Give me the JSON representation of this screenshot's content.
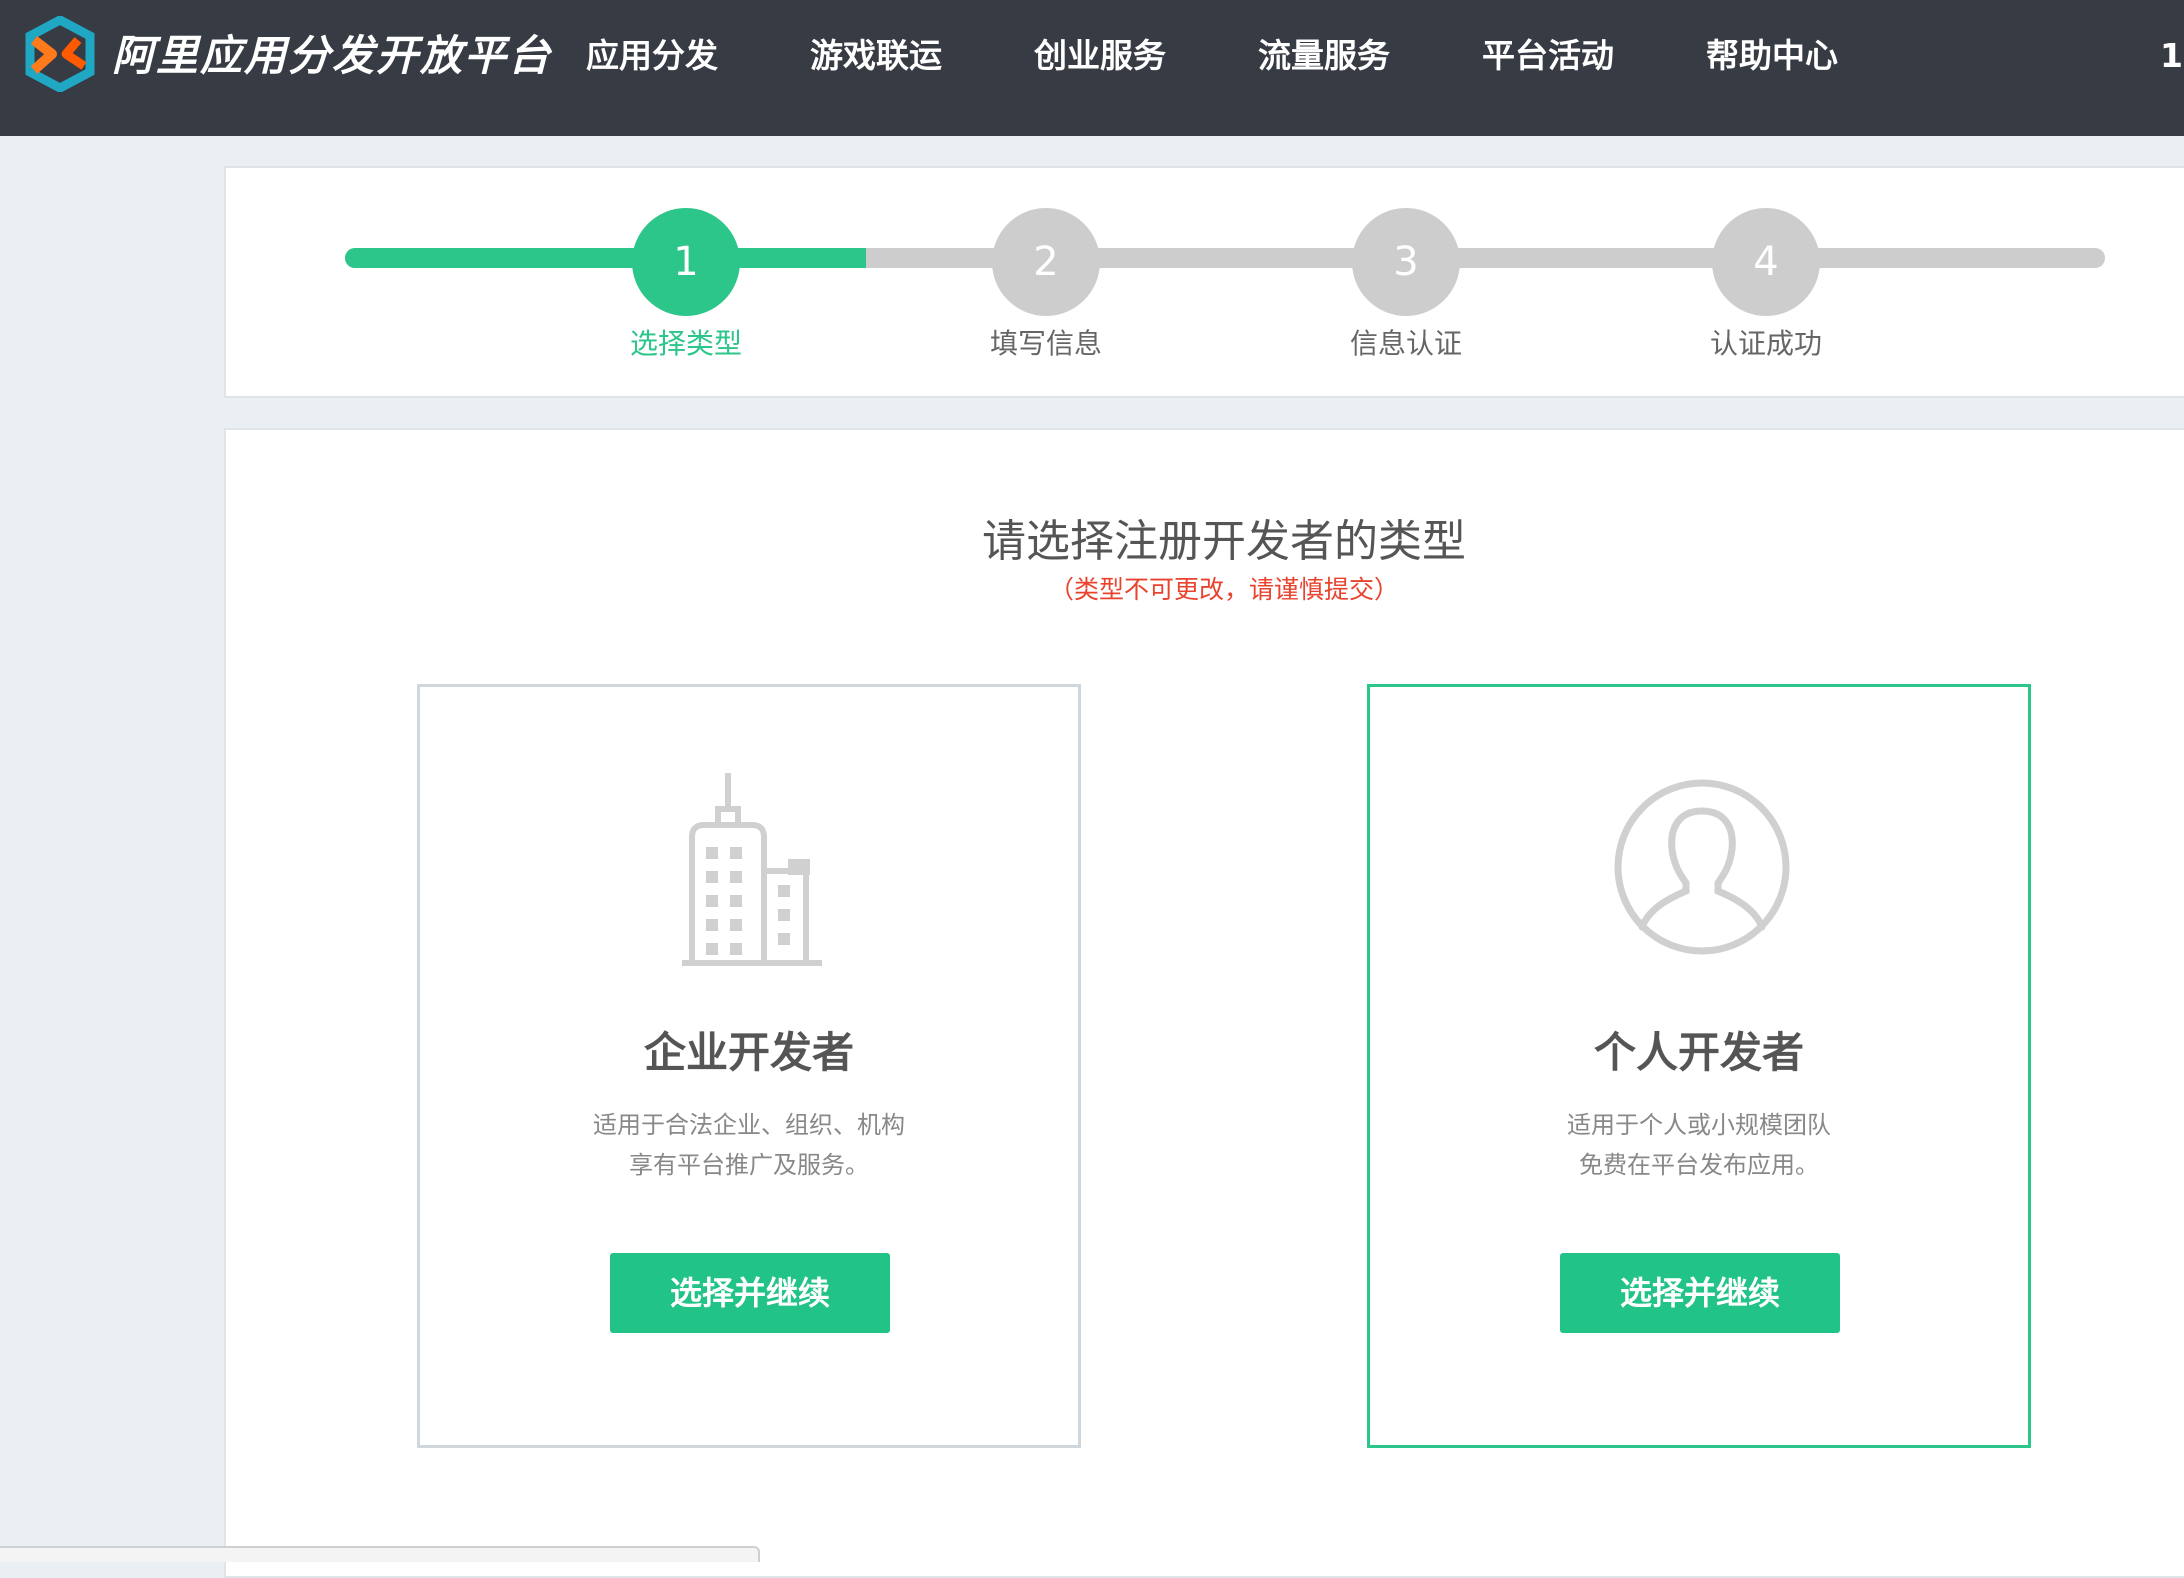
{
  "header": {
    "brand": "阿里应用分发开放平台",
    "nav": [
      "应用分发",
      "游戏联运",
      "创业服务",
      "流量服务",
      "平台活动",
      "帮助中心"
    ],
    "clipped": "1"
  },
  "steps": [
    {
      "num": "1",
      "label": "选择类型",
      "active": true
    },
    {
      "num": "2",
      "label": "填写信息",
      "active": false
    },
    {
      "num": "3",
      "label": "信息认证",
      "active": false
    },
    {
      "num": "4",
      "label": "认证成功",
      "active": false
    }
  ],
  "main": {
    "title": "请选择注册开发者的类型",
    "subtitle": "（类型不可更改，请谨慎提交）"
  },
  "cards": [
    {
      "icon": "building-icon",
      "title": "企业开发者",
      "desc1": "适用于合法企业、组织、机构",
      "desc2": "享有平台推广及服务。",
      "button": "选择并继续",
      "selected": false
    },
    {
      "icon": "person-icon",
      "title": "个人开发者",
      "desc1": "适用于个人或小规模团队",
      "desc2": "免费在平台发布应用。",
      "button": "选择并继续",
      "selected": true
    }
  ],
  "colors": {
    "accent": "#2cc68a",
    "button": "#22c386",
    "warning": "#e8432e",
    "header_bg": "#373b44"
  }
}
